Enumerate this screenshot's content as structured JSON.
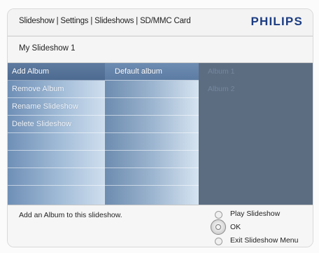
{
  "header": {
    "breadcrumb": "Slideshow | Settings | Slideshows | SD/MMC Card",
    "brand": "PHILIPS"
  },
  "subtitle": "My Slideshow 1",
  "menu": {
    "items": [
      {
        "label": "Add Album"
      },
      {
        "label": "Remove Album"
      },
      {
        "label": "Rename Slideshow"
      },
      {
        "label": "Delete Slideshow"
      }
    ]
  },
  "submenu": {
    "items": [
      {
        "label": "Default album"
      }
    ]
  },
  "albums": {
    "items": [
      {
        "label": "Album 1"
      },
      {
        "label": "Album 2"
      }
    ]
  },
  "footer": {
    "hint": "Add an Album to this slideshow.",
    "actions": [
      {
        "label": "Play Slideshow"
      },
      {
        "label": "OK"
      },
      {
        "label": "Exit Slideshow Menu"
      }
    ]
  }
}
